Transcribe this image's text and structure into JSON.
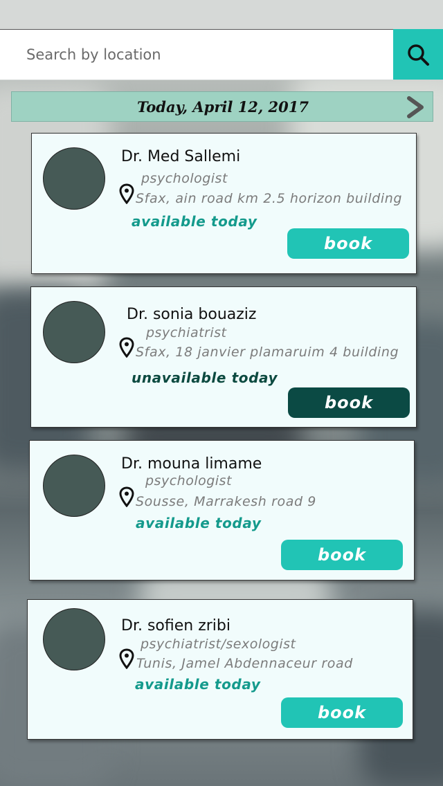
{
  "search": {
    "placeholder": "Search by location",
    "icon": "search-icon"
  },
  "date_bar": {
    "label": "Today, April 12, 2017",
    "next_icon": "chevron-right-icon"
  },
  "colors": {
    "accent": "#21c4b5",
    "available": "#149a8c",
    "unavailable": "#0c4a40",
    "book_available": "#21c4b5",
    "book_unavailable": "#0b4a44"
  },
  "doctors": [
    {
      "name": "Dr. Med Sallemi",
      "specialty": "psychologist",
      "address": "Sfax, ain road km 2.5 horizon building",
      "availability": "available today",
      "available": true,
      "book_label": "book"
    },
    {
      "name": "Dr. sonia bouaziz",
      "specialty": "psychiatrist",
      "address": "Sfax, 18 janvier plamaruim 4 building",
      "availability": "unavailable today",
      "available": false,
      "book_label": "book"
    },
    {
      "name": "Dr. mouna limame",
      "specialty": "psychologist",
      "address": "Sousse, Marrakesh road 9",
      "availability": "available today",
      "available": true,
      "book_label": "book"
    },
    {
      "name": "Dr. sofien zribi",
      "specialty": "psychiatrist/sexologist",
      "address": "Tunis, Jamel Abdennaceur road",
      "availability": "available today",
      "available": true,
      "book_label": "book"
    }
  ]
}
